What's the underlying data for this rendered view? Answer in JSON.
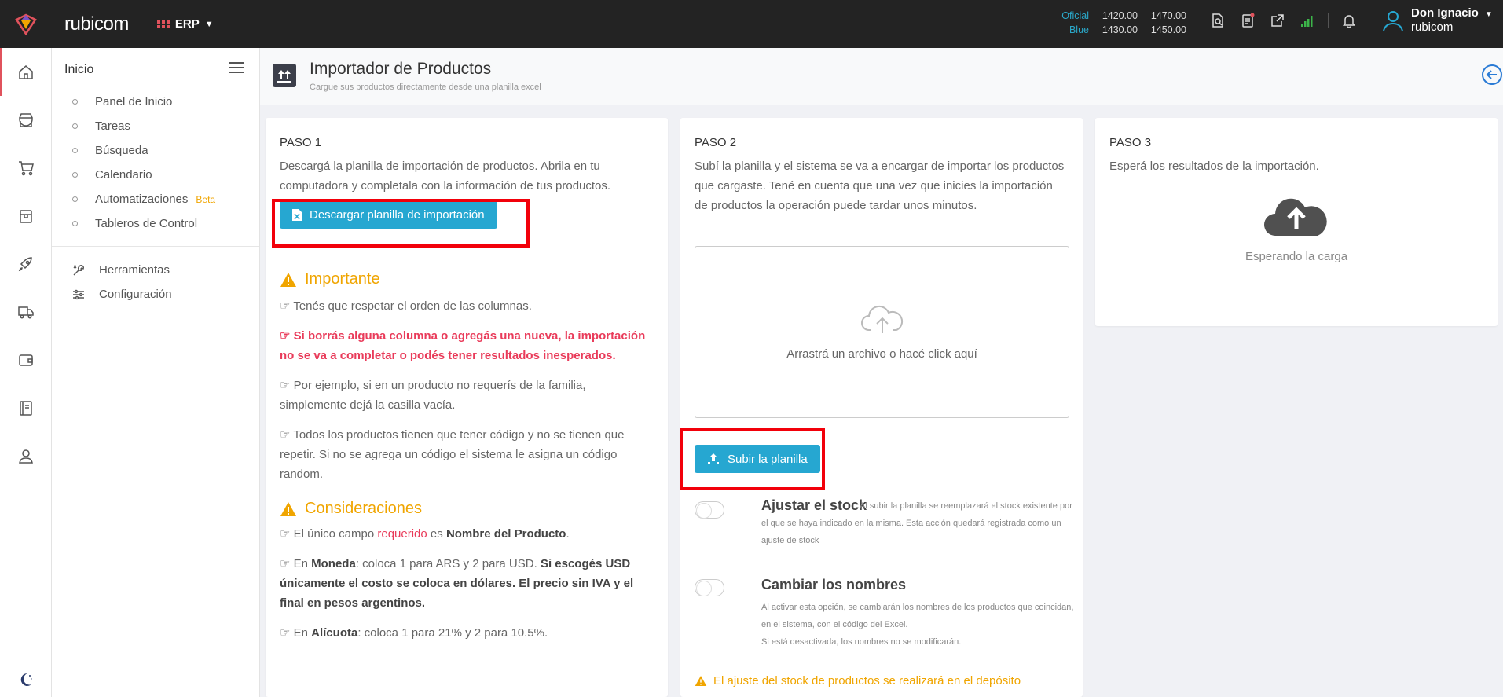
{
  "topbar": {
    "brand": "rubicom",
    "module": "ERP",
    "rates": {
      "oficial_label": "Oficial",
      "oficial_buy": "1420.00",
      "oficial_sell": "1470.00",
      "blue_label": "Blue",
      "blue_buy": "1430.00",
      "blue_sell": "1450.00"
    },
    "user_name": "Don Ignacio",
    "company": "rubicom"
  },
  "sidebar": {
    "title": "Inicio",
    "items": [
      {
        "label": "Panel de Inicio"
      },
      {
        "label": "Tareas"
      },
      {
        "label": "Búsqueda"
      },
      {
        "label": "Calendario"
      },
      {
        "label": "Automatizaciones",
        "badge": "Beta"
      },
      {
        "label": "Tableros de Control"
      }
    ],
    "tools": [
      {
        "label": "Herramientas"
      },
      {
        "label": "Configuración"
      }
    ]
  },
  "header": {
    "title": "Importador de Productos",
    "subtitle": "Cargue sus productos directamente desde una planilla excel"
  },
  "step1": {
    "label": "PASO 1",
    "text": "Descargá la planilla de importación de productos. Abrila en tu computadora y completala con la información de tus productos.",
    "button": "Descargar planilla de importación",
    "important_title": "Importante",
    "important_items": [
      "Tenés que respetar el orden de las columnas.",
      "Si borrás alguna columna o agregás una nueva, la importación no se va a completar o podés tener resultados inesperados.",
      "Por ejemplo, si en un producto no requerís de la familia, simplemente dejá la casilla vacía.",
      "Todos los productos tienen que tener código y no se tienen que repetir. Si no se agrega un código el sistema le asigna un código random."
    ],
    "considerations_title": "Consideraciones",
    "c1_a": "El único campo ",
    "c1_b": "requerido",
    "c1_c": " es ",
    "c1_d": "Nombre del Producto",
    "c1_e": ".",
    "c2_a": "En ",
    "c2_b": "Moneda",
    "c2_c": ": coloca 1 para ARS y 2 para USD. ",
    "c2_d": "Si escogés USD únicamente el costo se coloca en dólares. El precio sin IVA y el final en pesos argentinos.",
    "c3_a": "En ",
    "c3_b": "Alícuota",
    "c3_c": ": coloca 1 para 21% y 2 para 10.5%."
  },
  "step2": {
    "label": "PASO 2",
    "text": "Subí la planilla y el sistema se va a encargar de importar los productos que cargaste. Tené en cuenta que una vez que inicies la importación de productos la operación puede tardar unos minutos.",
    "dropzone": "Arrastrá un archivo o hacé click aquí",
    "button": "Subir la planilla",
    "stock_title": "Ajustar el stock",
    "stock_desc": "Al subir la planilla se reemplazará el stock existente por el que se haya indicado en la misma. Esta acción quedará registrada como un ajuste de stock",
    "names_title": "Cambiar los nombres",
    "names_desc1": "Al activar esta opción, se cambiarán los nombres de los productos que coincidan, en el sistema, con el código del Excel.",
    "names_desc2": "Si está desactivada, los nombres no se modificarán.",
    "warning": "El ajuste del stock de productos se realizará en el depósito"
  },
  "step3": {
    "label": "PASO 3",
    "text": "Esperá los resultados de la importación.",
    "waiting": "Esperando la carga"
  },
  "colors": {
    "accent": "#26a7d1",
    "warning": "#f0a500",
    "danger": "#e93b5a",
    "highlight": "#f2000a"
  }
}
